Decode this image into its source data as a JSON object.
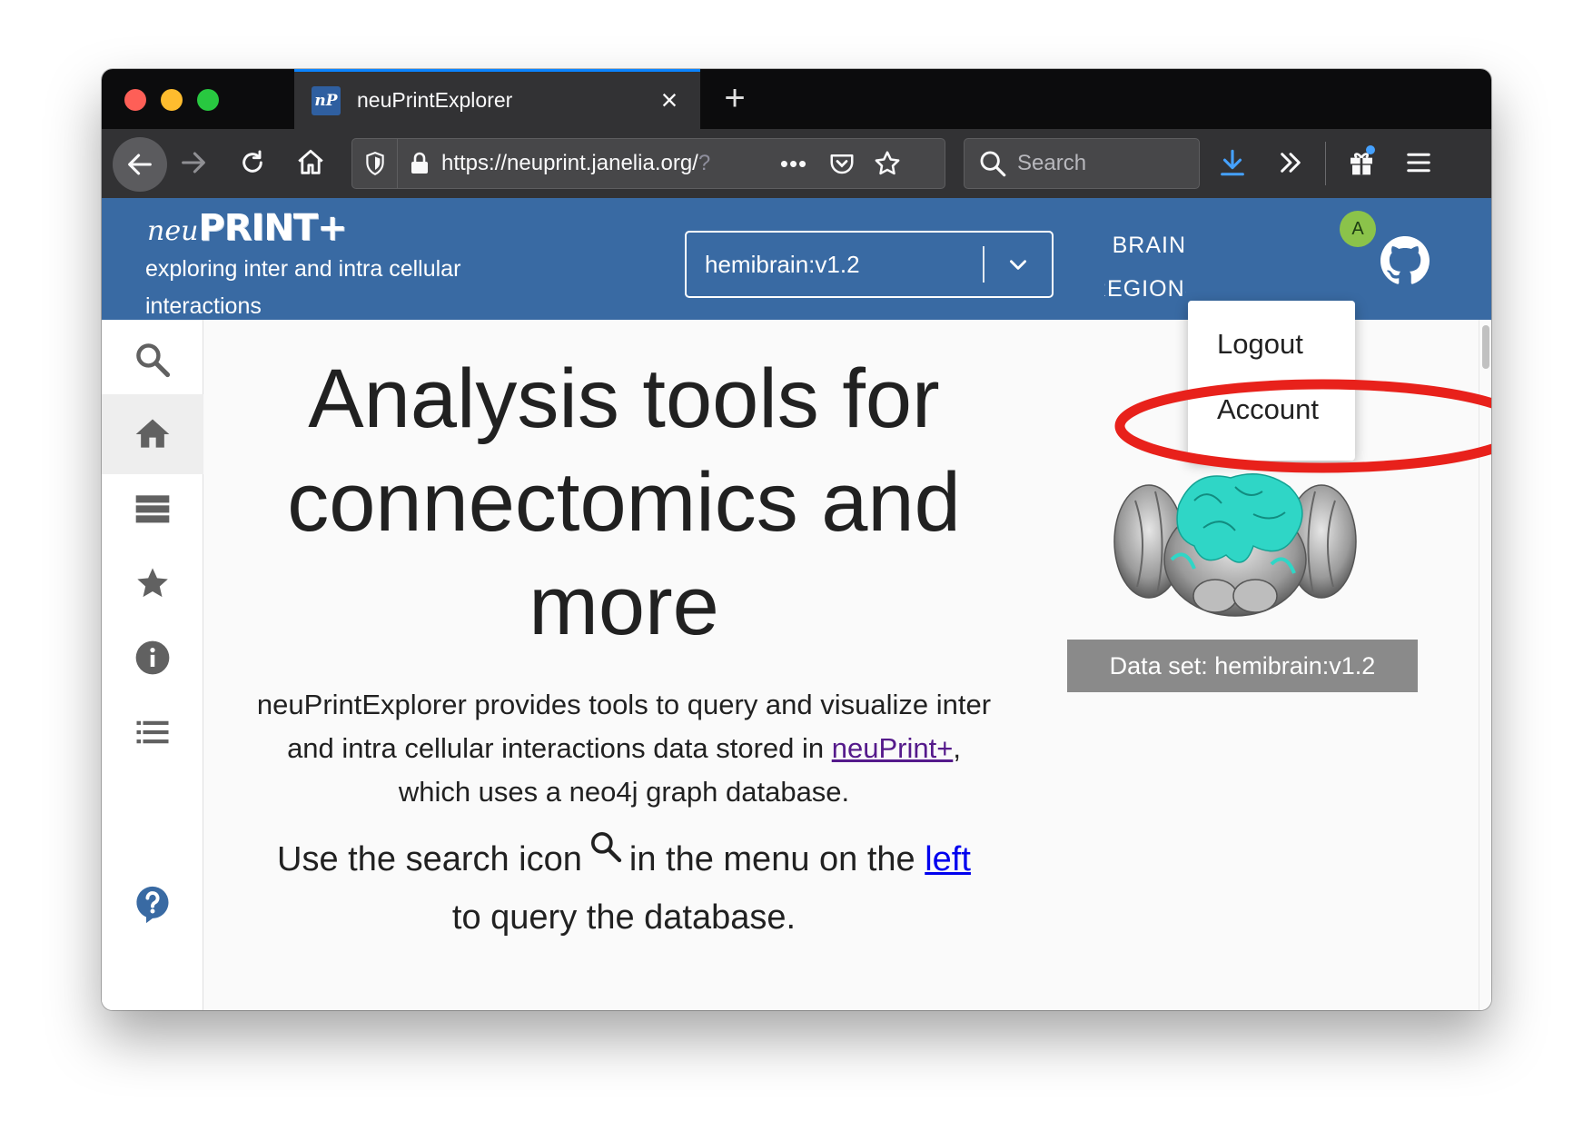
{
  "browser": {
    "tab": {
      "title": "neuPrintExplorer",
      "favicon_text": "nP",
      "close": "×"
    },
    "new_tab": "+",
    "url": {
      "text": "https://neuprint.janelia.org/",
      "tail": "?",
      "more": "•••"
    },
    "search_placeholder": "Search"
  },
  "app": {
    "logo": {
      "italic": "neu",
      "bold": "PRINT+"
    },
    "tagline": "exploring inter and intra cellular interactions",
    "dataset_select": "hemibrain:v1.2",
    "brain_regions": [
      "BRAIN",
      "REGIONS"
    ],
    "avatar_letter": "A",
    "menu": {
      "logout": "Logout",
      "account": "Account"
    }
  },
  "content": {
    "headline": "Analysis tools for connectomics and more",
    "intro_before": "neuPrintExplorer provides tools to query and visualize inter and intra cellular interactions data stored in ",
    "intro_link": "neuPrint+",
    "intro_after": ", which uses a neo4j graph database.",
    "usage_before": "Use the search icon",
    "usage_middle": "in the menu on the",
    "usage_link": "left",
    "usage_after": "to query the database.",
    "dataset_badge": "Data set: hemibrain:v1.2"
  },
  "colors": {
    "app_header": "#396aa3",
    "annotation_ring": "#e8211b",
    "brain_highlight": "#2fd6c6",
    "tab_accent": "#0a84ff"
  }
}
